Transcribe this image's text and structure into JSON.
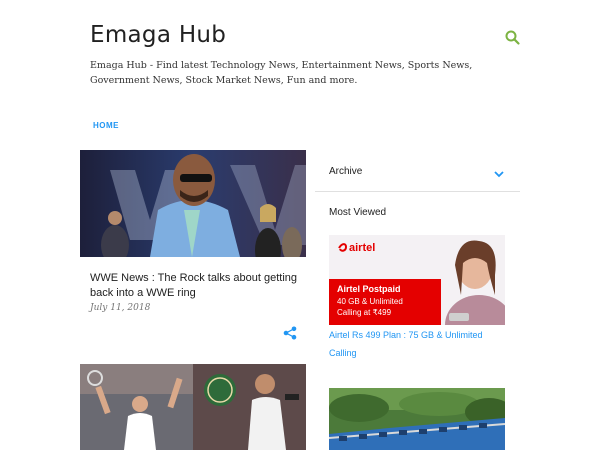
{
  "header": {
    "title": "Emaga Hub",
    "description": "Emaga Hub - Find latest Technology News, Entertainment News, Sports News, Government News, Stock Market News, Fun and more."
  },
  "nav": {
    "home": "HOME"
  },
  "posts": [
    {
      "title": "WWE News : The Rock talks about getting back into a WWE ring",
      "date": "July 11, 2018"
    }
  ],
  "sidebar": {
    "archive_label": "Archive",
    "most_viewed_title": "Most Viewed",
    "items": [
      {
        "caption": "Airtel Rs 499 Plan : 75 GB & Unlimited Calling",
        "banner": {
          "brand": "airtel",
          "headline": "Airtel Postpaid",
          "line1": "40 GB & Unlimited",
          "line2": "Calling at ₹499"
        }
      }
    ]
  },
  "colors": {
    "accent": "#2196f3",
    "search_icon": "#7cb342",
    "airtel_red": "#e40000"
  },
  "icons": [
    "search-icon",
    "share-icon",
    "chevron-down-icon"
  ]
}
